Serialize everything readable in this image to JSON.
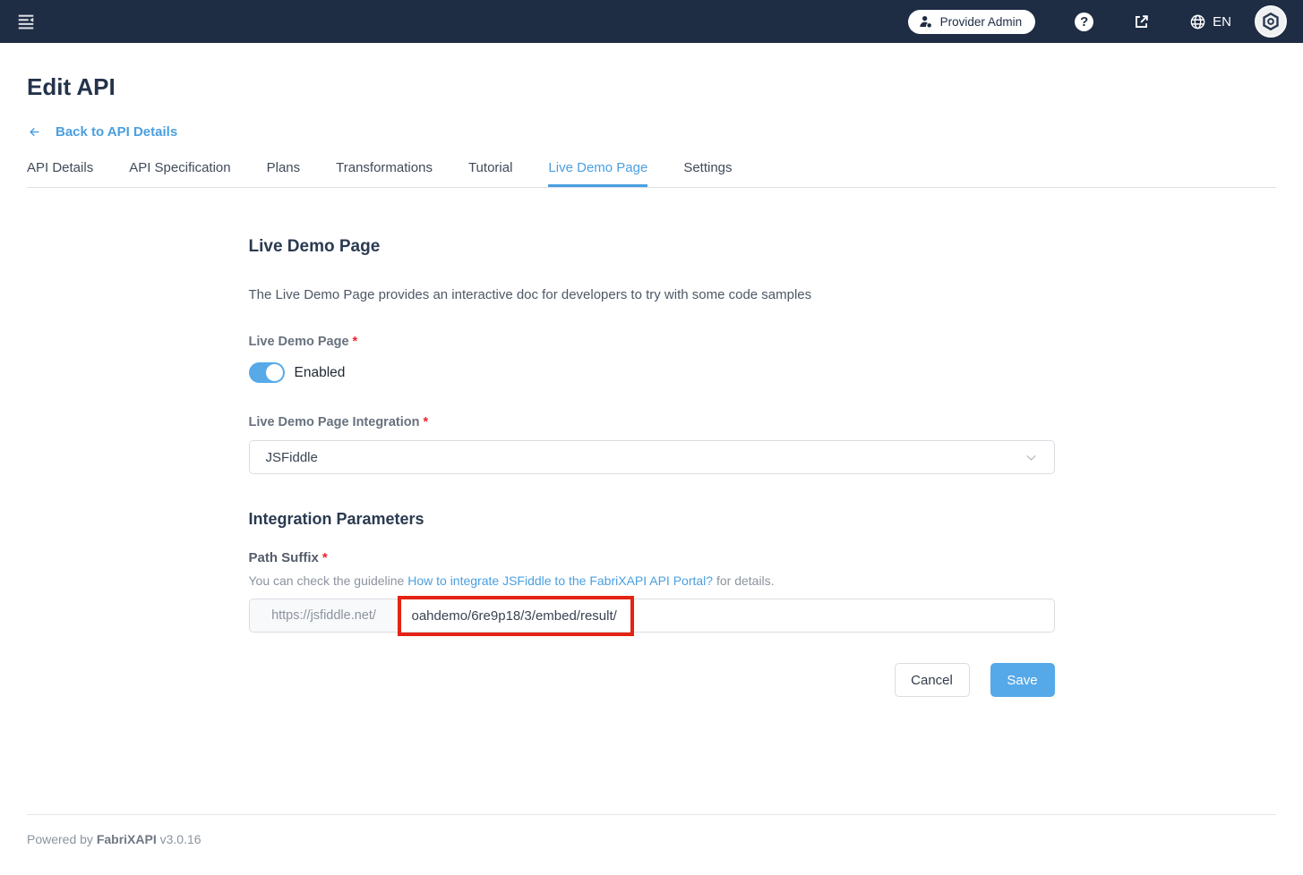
{
  "topbar": {
    "provider_admin_label": "Provider Admin",
    "language": "EN"
  },
  "page": {
    "title": "Edit API",
    "back_link": "Back to API Details"
  },
  "tabs": [
    {
      "label": "API Details",
      "active": false
    },
    {
      "label": "API Specification",
      "active": false
    },
    {
      "label": "Plans",
      "active": false
    },
    {
      "label": "Transformations",
      "active": false
    },
    {
      "label": "Tutorial",
      "active": false
    },
    {
      "label": "Live Demo Page",
      "active": true
    },
    {
      "label": "Settings",
      "active": false
    }
  ],
  "form": {
    "section_title": "Live Demo Page",
    "section_description": "The Live Demo Page provides an interactive doc for developers to try with some code samples",
    "required_mark": "*",
    "live_demo_toggle": {
      "label": "Live Demo Page",
      "state": "Enabled"
    },
    "integration": {
      "label": "Live Demo Page Integration",
      "selected": "JSFiddle"
    },
    "parameters_title": "Integration Parameters",
    "path_suffix": {
      "label": "Path Suffix",
      "hint_prefix": "You can check the guideline ",
      "hint_link": "How to integrate JSFiddle to the FabriXAPI API Portal?",
      "hint_suffix": " for details.",
      "url_prefix": "https://jsfiddle.net/",
      "value": "oahdemo/6re9p18/3/embed/result/"
    },
    "buttons": {
      "cancel": "Cancel",
      "save": "Save"
    }
  },
  "footer": {
    "powered_by": "Powered by ",
    "brand": "FabriXAPI",
    "version": " v3.0.16"
  },
  "colors": {
    "topbar_bg": "#1e2c44",
    "accent_blue": "#4a9fe0",
    "save_button_blue": "#56a9e8",
    "annotation_red": "#e42313",
    "required_red": "#f5222d"
  }
}
